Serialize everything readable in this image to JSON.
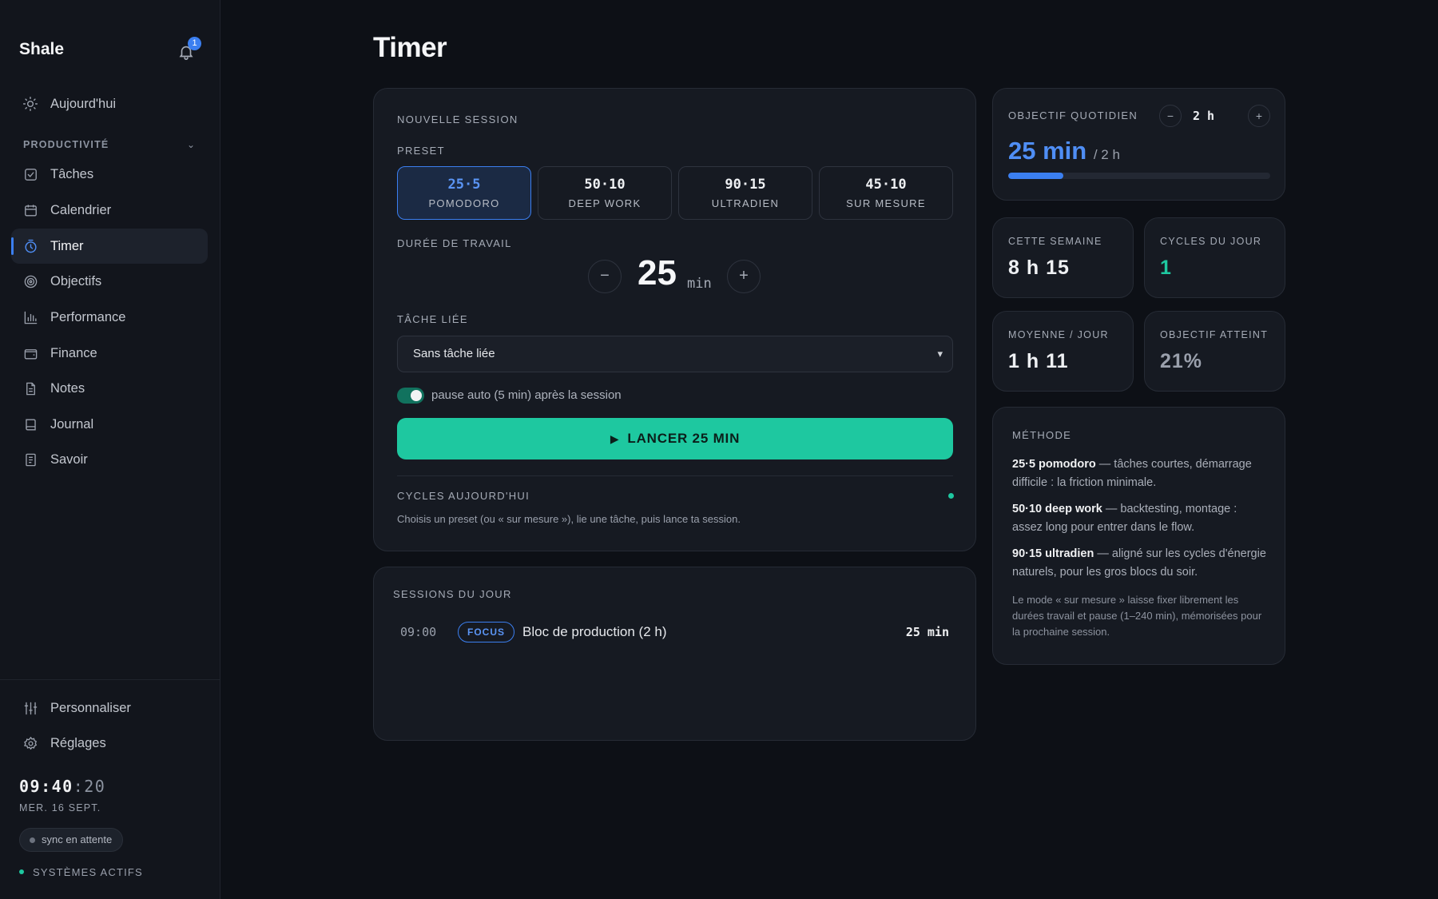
{
  "sidebar": {
    "brand": "Shale",
    "notification_count": "1",
    "items_top": [
      {
        "label": "Aujourd'hui",
        "icon": "sun-icon"
      }
    ],
    "section_label": "PRODUCTIVITÉ",
    "items": [
      {
        "label": "Tâches",
        "icon": "checkbox-icon"
      },
      {
        "label": "Calendrier",
        "icon": "calendar-icon"
      },
      {
        "label": "Timer",
        "icon": "stopwatch-icon",
        "active": true
      },
      {
        "label": "Objectifs",
        "icon": "target-icon"
      },
      {
        "label": "Performance",
        "icon": "bar-chart-icon"
      },
      {
        "label": "Finance",
        "icon": "wallet-icon"
      },
      {
        "label": "Notes",
        "icon": "document-icon"
      },
      {
        "label": "Journal",
        "icon": "book-icon"
      },
      {
        "label": "Savoir",
        "icon": "notebook-icon"
      }
    ],
    "bottom_items": [
      {
        "label": "Personnaliser",
        "icon": "sliders-icon"
      },
      {
        "label": "Réglages",
        "icon": "gear-icon"
      }
    ],
    "clock_hm": "09:40",
    "clock_s": ":20",
    "date": "MER. 16 SEPT.",
    "sync_label": "sync en attente",
    "system_status": "SYSTÈMES ACTIFS"
  },
  "page_title": "Timer",
  "session": {
    "header": "NOUVELLE SESSION",
    "preset_label": "PRESET",
    "presets": [
      {
        "value": "25·5",
        "name": "POMODORO",
        "selected": true
      },
      {
        "value": "50·10",
        "name": "DEEP WORK"
      },
      {
        "value": "90·15",
        "name": "ULTRADIEN"
      },
      {
        "value": "45·10",
        "name": "SUR MESURE"
      }
    ],
    "duration_label": "DURÉE DE TRAVAIL",
    "duration_value": "25",
    "duration_unit": "min",
    "minus": "−",
    "plus": "+",
    "task_label": "TÂCHE LIÉE",
    "task_selected": "Sans tâche liée",
    "auto_pause_label": "pause auto (5 min) après la session",
    "auto_pause_on": true,
    "launch_label": "LANCER 25 MIN",
    "cycles_label": "CYCLES AUJOURD'HUI",
    "hint": "Choisis un preset (ou « sur mesure »), lie une tâche, puis lance ta session."
  },
  "day_sessions": {
    "header": "SESSIONS DU JOUR",
    "rows": [
      {
        "time": "09:00",
        "badge": "FOCUS",
        "title": "Bloc de production (2 h)",
        "duration": "25 min"
      }
    ]
  },
  "goal": {
    "label": "OBJECTIF QUOTIDIEN",
    "target_value": "2 h",
    "done": "25 min",
    "of": "/ 2 h",
    "progress_fraction": 0.21
  },
  "stats": [
    {
      "label": "CETTE SEMAINE",
      "value": "8 h 15",
      "color": "#eef0f3"
    },
    {
      "label": "CYCLES DU JOUR",
      "value": "1",
      "color": "#1ec8a0"
    },
    {
      "label": "MOYENNE / JOUR",
      "value": "1 h 11",
      "color": "#eef0f3"
    },
    {
      "label": "OBJECTIF ATTEINT",
      "value": "21%",
      "color": "#9aa0ac"
    }
  ],
  "method": {
    "header": "MÉTHODE",
    "items": [
      {
        "bold": "25·5 pomodoro",
        "text": " — tâches courtes, démarrage difficile : la friction minimale."
      },
      {
        "bold": "50·10 deep work",
        "text": " — backtesting, montage : assez long pour entrer dans le flow."
      },
      {
        "bold": "90·15 ultradien",
        "text": " — aligné sur les cycles d'énergie naturels, pour les gros blocs du soir."
      }
    ],
    "note": "Le mode « sur mesure » laisse fixer librement les durées travail et pause (1–240 min), mémorisées pour la prochaine session."
  },
  "colors": {
    "accent_blue": "#3b7ff0",
    "accent_green": "#1ec8a0",
    "background": "#0d1016"
  }
}
